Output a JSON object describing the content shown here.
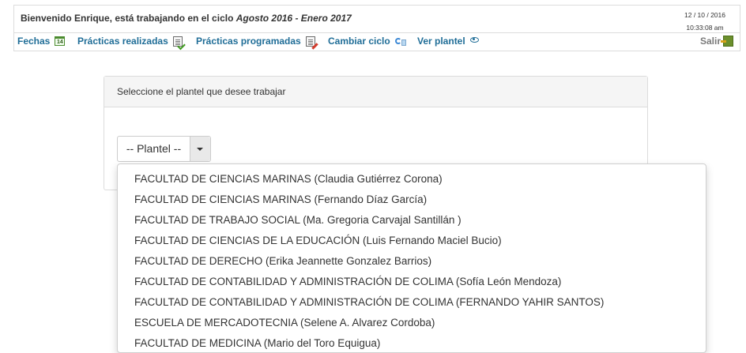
{
  "header": {
    "welcome_prefix": "Bienvenido Enrique, está trabajando en el ciclo ",
    "cycle": "Agosto 2016 - Enero 2017",
    "date": "12 / 10 / 2016",
    "time": "10:33:08 am"
  },
  "nav": {
    "items": [
      {
        "label": "Fechas",
        "icon": "calendar-icon"
      },
      {
        "label": "Prácticas realizadas",
        "icon": "checklist-icon"
      },
      {
        "label": "Prácticas programadas",
        "icon": "schedule-edit-icon"
      },
      {
        "label": "Cambiar ciclo",
        "icon": "cycle-icon"
      },
      {
        "label": "Ver plantel",
        "icon": "eye-icon"
      }
    ],
    "calendar_day": "14",
    "logout_label": "Salir"
  },
  "panel": {
    "title": "Seleccione el plantel que desee trabajar",
    "select_label": "-- Plantel --"
  },
  "dropdown": {
    "options": [
      "FACULTAD DE CIENCIAS MARINAS (Claudia Gutiérrez Corona)",
      "FACULTAD DE CIENCIAS MARINAS (Fernando Díaz García)",
      "FACULTAD DE TRABAJO SOCIAL (Ma. Gregoria Carvajal Santillán )",
      "FACULTAD DE CIENCIAS DE LA EDUCACIÓN (Luis Fernando Maciel Bucio)",
      "FACULTAD DE DERECHO (Erika Jeannette Gonzalez Barrios)",
      "FACULTAD DE CONTABILIDAD Y ADMINISTRACIÓN DE COLIMA (Sofía León Mendoza)",
      "FACULTAD DE CONTABILIDAD Y ADMINISTRACIÓN DE COLIMA (FERNANDO YAHIR SANTOS)",
      "ESCUELA DE MERCADOTECNIA (Selene A. Alvarez Cordoba)",
      "FACULTAD DE MEDICINA (Mario del Toro Equigua)"
    ]
  }
}
